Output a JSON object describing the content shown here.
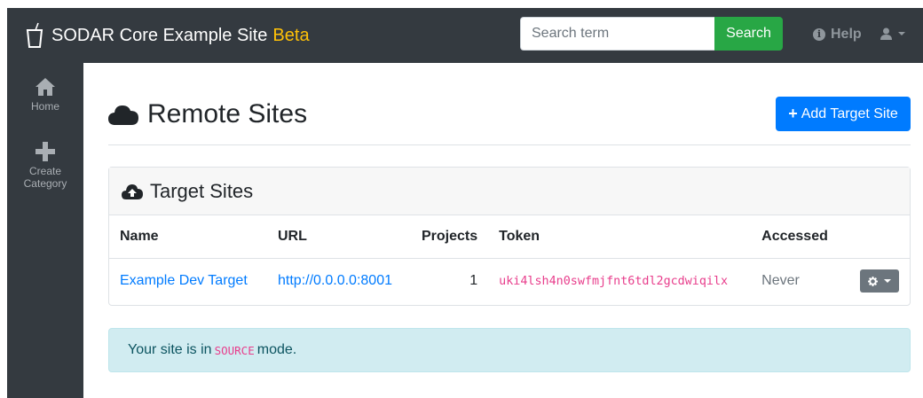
{
  "navbar": {
    "brand_name": "SODAR Core Example Site",
    "brand_badge": "Beta",
    "search": {
      "placeholder": "Search term",
      "value": "",
      "button_label": "Search"
    },
    "help_label": "Help",
    "icons": [
      "cup-logo-icon",
      "info-circle-icon",
      "user-icon",
      "caret-down-icon"
    ]
  },
  "sidebar": {
    "items": [
      {
        "label": "Home",
        "icon": "home-icon"
      },
      {
        "label": "Create Category",
        "icon": "plus-icon"
      }
    ]
  },
  "page": {
    "title": "Remote Sites",
    "title_icon": "cloud-icon",
    "add_button_label": "Add Target Site"
  },
  "card": {
    "title": "Target Sites",
    "title_icon": "cloud-upload-icon",
    "columns": [
      "Name",
      "URL",
      "Projects",
      "Token",
      "Accessed"
    ],
    "rows": [
      {
        "name": "Example Dev Target",
        "url": "http://0.0.0.0:8001",
        "projects": "1",
        "token": "uki4lsh4n0swfmjfnt6tdl2gcdwiqilx",
        "accessed": "Never"
      }
    ]
  },
  "alert": {
    "prefix": "Your site is in",
    "mode": "SOURCE",
    "suffix": "mode."
  },
  "colors": {
    "navbar_bg": "#343a40",
    "brand_badge": "#ffc107",
    "search_button": "#28a745",
    "primary": "#007bff",
    "token": "#e83e8c",
    "alert_bg": "#d1ecf1"
  }
}
